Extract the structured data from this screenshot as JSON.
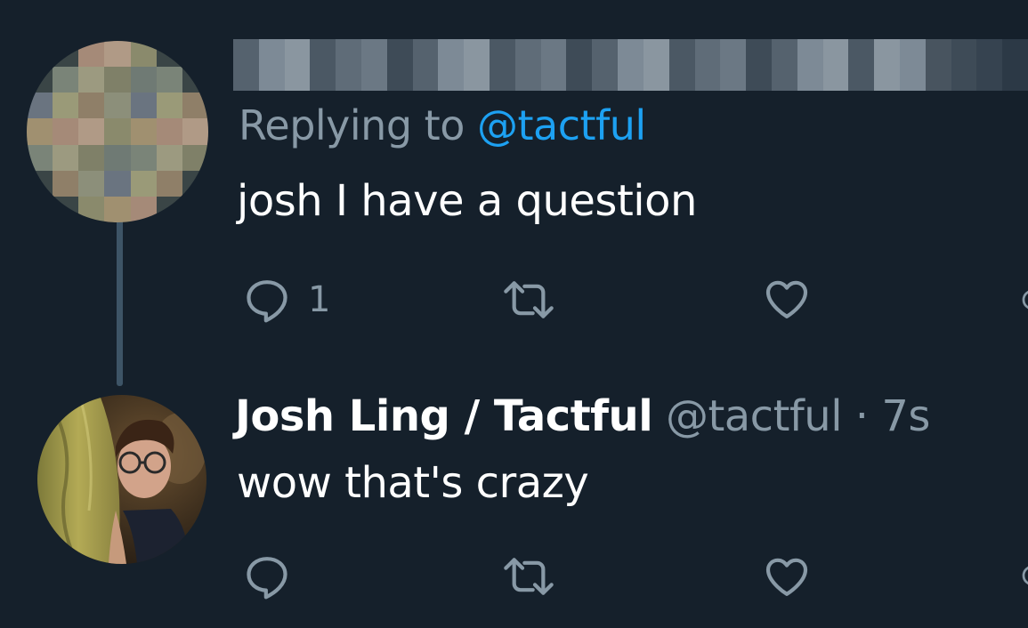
{
  "tweet1": {
    "replying_prefix": "Replying to ",
    "replying_handle": "@tactful",
    "text": "josh I have a question",
    "actions": {
      "reply_count": "1",
      "reply_icon": "reply-icon",
      "retweet_icon": "retweet-icon",
      "like_icon": "heart-icon"
    }
  },
  "tweet2": {
    "display_name": "Josh Ling / Tactful",
    "handle": "@tactful",
    "separator": " · ",
    "timestamp": "7s",
    "text": "wow that's crazy",
    "actions": {
      "reply_icon": "reply-icon",
      "retweet_icon": "retweet-icon",
      "like_icon": "heart-icon"
    }
  },
  "colors": {
    "background": "#15202b",
    "secondary_text": "#8899a6",
    "link": "#1da1f2",
    "thread_line": "#3d5466",
    "primary_text": "#ffffff"
  }
}
